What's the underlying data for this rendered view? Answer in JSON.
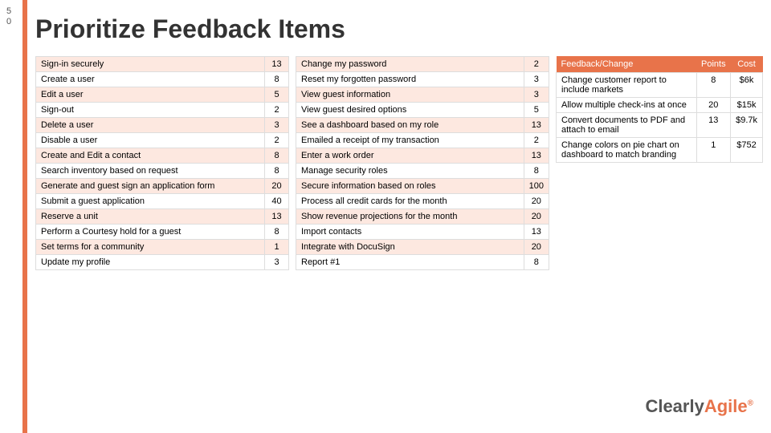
{
  "slide": {
    "number_line1": "5",
    "number_line2": "0",
    "title": "Prioritize Feedback Items"
  },
  "left_table_col1": [
    {
      "label": "Sign-in securely",
      "points": "13"
    },
    {
      "label": "Create a user",
      "points": "8"
    },
    {
      "label": "Edit a user",
      "points": "5"
    },
    {
      "label": "Sign-out",
      "points": "2"
    },
    {
      "label": "Delete a user",
      "points": "3"
    },
    {
      "label": "Disable a user",
      "points": "2"
    },
    {
      "label": "Create and Edit a contact",
      "points": "8"
    },
    {
      "label": "Search inventory based on request",
      "points": "8"
    },
    {
      "label": "Generate and guest sign an application form",
      "points": "20"
    },
    {
      "label": "Submit a guest application",
      "points": "40"
    },
    {
      "label": "Reserve a unit",
      "points": "13"
    },
    {
      "label": "Perform a Courtesy hold for a guest",
      "points": "8"
    },
    {
      "label": "Set terms for a community",
      "points": "1"
    },
    {
      "label": "Update my profile",
      "points": "3"
    }
  ],
  "left_table_col2": [
    {
      "label": "Change my password",
      "points": "2"
    },
    {
      "label": "Reset my forgotten password",
      "points": "3"
    },
    {
      "label": "View guest information",
      "points": "3"
    },
    {
      "label": "View guest desired options",
      "points": "5"
    },
    {
      "label": "See a dashboard based on my role",
      "points": "13"
    },
    {
      "label": "Emailed a receipt of my transaction",
      "points": "2"
    },
    {
      "label": "Enter a work order",
      "points": "13"
    },
    {
      "label": "Manage security roles",
      "points": "8"
    },
    {
      "label": "Secure information based on roles",
      "points": "100"
    },
    {
      "label": "Process all credit cards for the month",
      "points": "20"
    },
    {
      "label": "Show revenue projections for the month",
      "points": "20"
    },
    {
      "label": "Import contacts",
      "points": "13"
    },
    {
      "label": "Integrate with DocuSign",
      "points": "20"
    },
    {
      "label": "Report #1",
      "points": "8"
    }
  ],
  "right_table": {
    "headers": [
      "Feedback/Change",
      "Points",
      "Cost"
    ],
    "rows": [
      {
        "label": "Change customer report to include markets",
        "points": "8",
        "cost": "$6k"
      },
      {
        "label": "Allow multiple check-ins at once",
        "points": "20",
        "cost": "$15k"
      },
      {
        "label": "Convert documents to PDF and attach to email",
        "points": "13",
        "cost": "$9.7k"
      },
      {
        "label": "Change colors on pie chart on dashboard to match branding",
        "points": "1",
        "cost": "$752"
      }
    ]
  },
  "logo": {
    "clearly": "Clearly",
    "agile": "Agile",
    "dot": "®"
  }
}
